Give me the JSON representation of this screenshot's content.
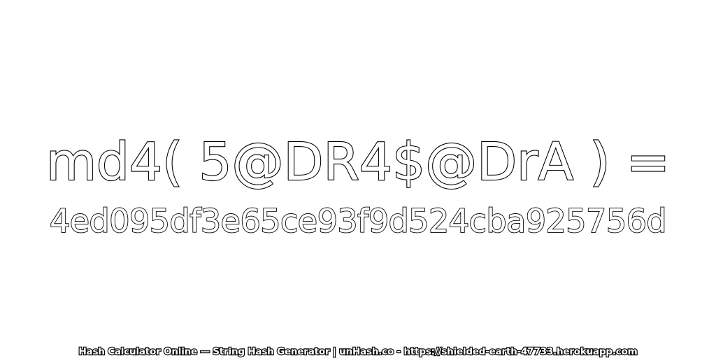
{
  "expression": "md4( 5@DR4$@DrA ) =",
  "digest": "4ed095df3e65ce93f9d524cba925756d",
  "footer": "Hash Calculator Online — String Hash Generator | unHash.co - https://shielded-earth-47733.herokuapp.com",
  "colors": {
    "background": "#ffffff",
    "text_fill": "#ffffff",
    "text_outline": "#000000"
  }
}
